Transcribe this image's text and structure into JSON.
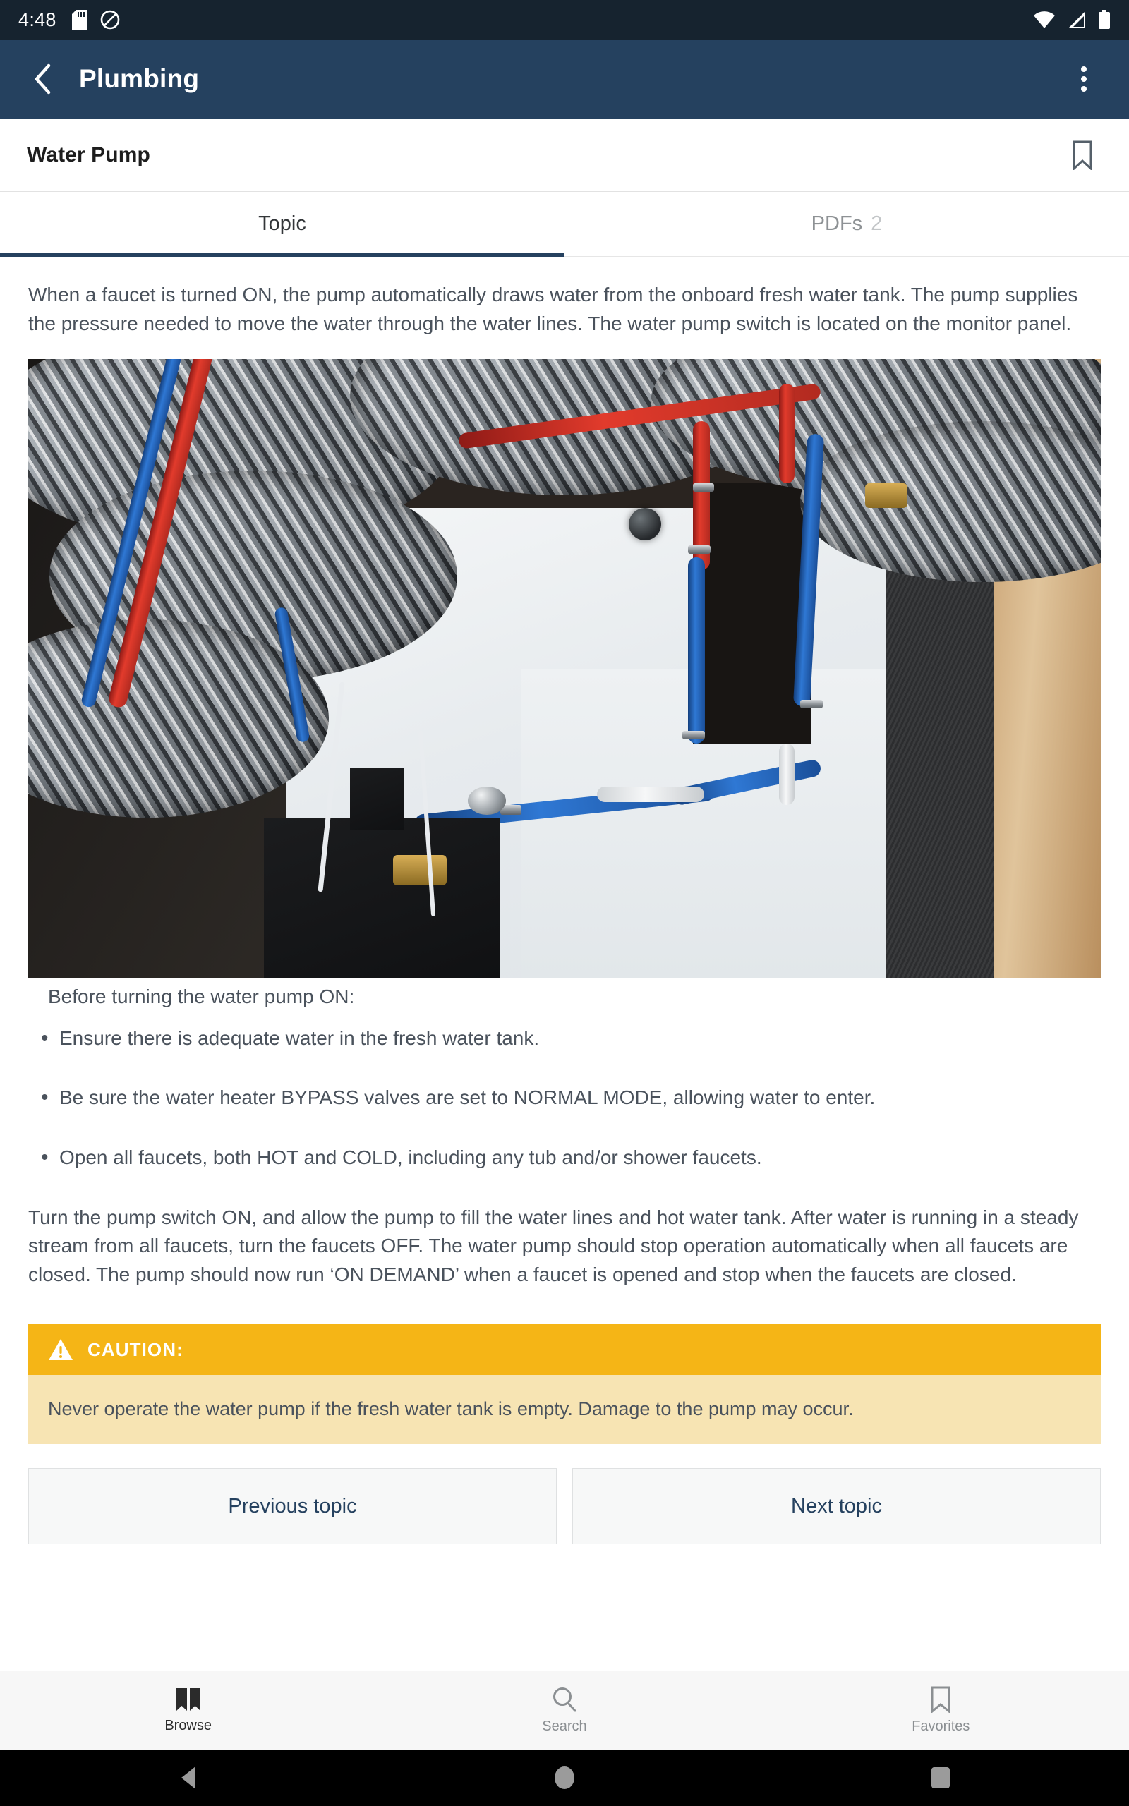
{
  "status_bar": {
    "time": "4:48",
    "icons_left": [
      "sd-card-icon",
      "do-not-disturb-icon"
    ],
    "icons_right": [
      "wifi-icon",
      "cellular-signal-icon",
      "battery-icon"
    ],
    "background": "#16232f"
  },
  "app_bar": {
    "back_icon": "chevron-left-icon",
    "title": "Plumbing",
    "overflow_icon": "more-vertical-icon",
    "background": "#25415f"
  },
  "topic_header": {
    "title": "Water Pump",
    "bookmark_icon": "bookmark-outline-icon"
  },
  "tabs": [
    {
      "label": "Topic",
      "badge": "",
      "active": true
    },
    {
      "label": "PDFs",
      "badge": "2",
      "active": false
    }
  ],
  "content": {
    "intro_paragraph": "When a faucet is turned ON, the pump automatically draws water from the onboard fresh water tank. The pump supplies the pressure needed to move the water through the water lines. The water pump switch is located on the monitor panel.",
    "image_alt": "RV plumbing bay with insulated ducting and red and blue PEX water lines",
    "bullet_intro": "Before turning the water pump ON:",
    "bullets": [
      "Ensure there is adequate water in the fresh water tank.",
      "Be sure the water heater BYPASS valves are set to NORMAL MODE, allowing water to enter.",
      "Open all faucets, both HOT and COLD, including any tub and/or shower faucets."
    ],
    "body_paragraph": "Turn the pump switch ON, and allow the pump to fill the water lines and hot water tank. After water is running in a steady stream from all faucets, turn the faucets OFF. The water pump should stop operation automatically when all faucets are closed. The pump should now run ‘ON DEMAND’ when a faucet is opened and stop when the faucets are closed."
  },
  "caution": {
    "icon": "warning-triangle-icon",
    "label": "CAUTION:",
    "text": "Never operate the water pump if the fresh water tank is empty. Damage to the pump may occur.",
    "header_color": "#f5b516",
    "body_color": "#f7e4b3"
  },
  "nav_buttons": {
    "previous": "Previous topic",
    "next": "Next topic"
  },
  "bottom_nav": [
    {
      "label": "Browse",
      "icon": "open-book-icon",
      "active": true
    },
    {
      "label": "Search",
      "icon": "search-icon",
      "active": false
    },
    {
      "label": "Favorites",
      "icon": "bookmark-outline-icon",
      "active": false
    }
  ],
  "android_nav": {
    "back": "back-triangle-icon",
    "home": "home-circle-icon",
    "recents": "recents-square-icon"
  },
  "colors": {
    "primary": "#25415f",
    "status_bar": "#16232f",
    "body_text": "#4a525c",
    "caution_header": "#f5b516",
    "caution_body": "#f7e4b3"
  }
}
